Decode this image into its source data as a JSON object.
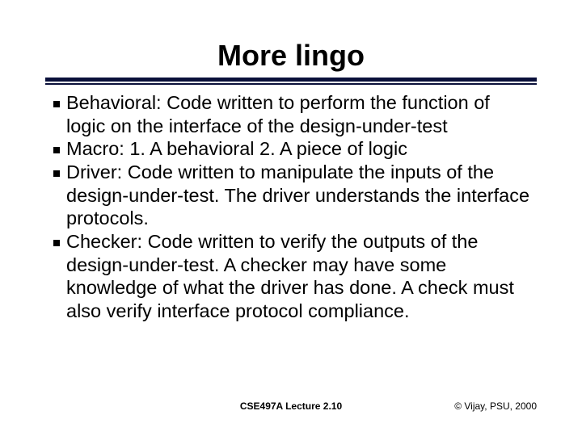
{
  "slide": {
    "title": "More lingo",
    "bullets": [
      "Behavioral: Code written to perform the function of logic on the interface of the design-under-test",
      "Macro: 1. A behavioral  2. A piece of logic",
      "Driver:  Code written to manipulate the inputs of the design-under-test.  The driver understands the interface protocols.",
      "Checker:  Code written to verify the outputs of the design-under-test.  A checker may have some knowledge of what the driver has done.  A check must also verify interface protocol compliance."
    ],
    "footer_center": "CSE497A Lecture 2.10",
    "footer_right": "© Vijay, PSU, 2000"
  }
}
